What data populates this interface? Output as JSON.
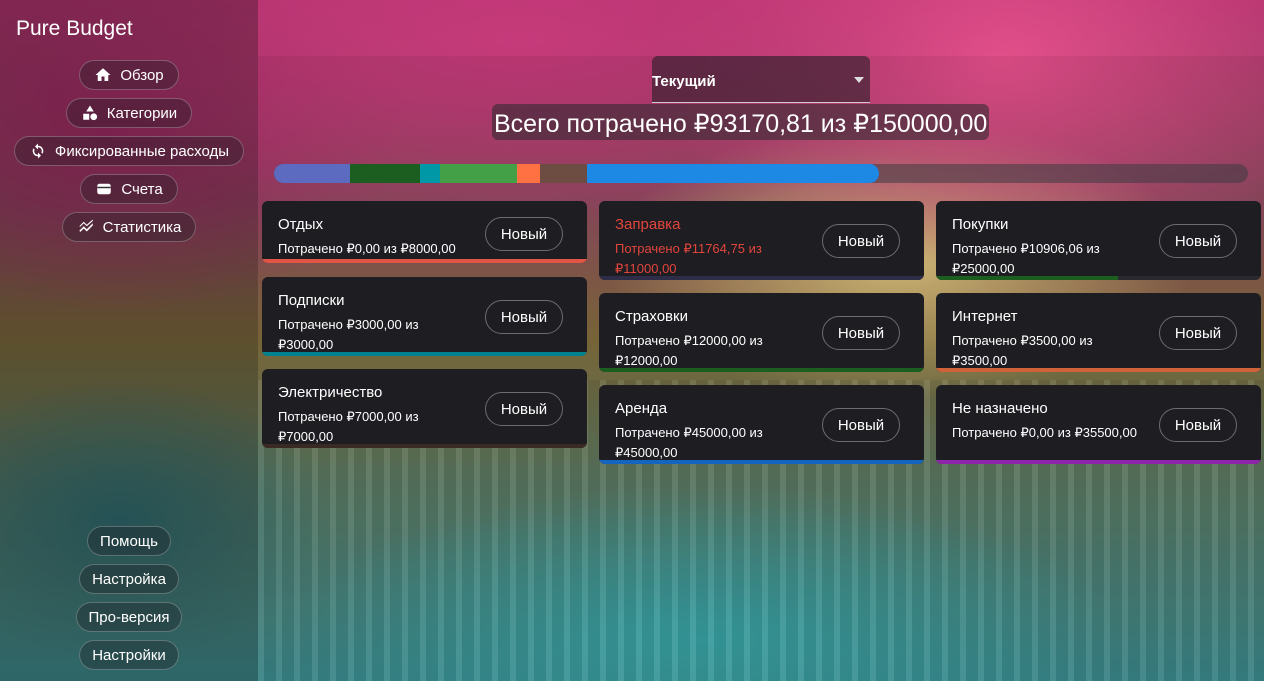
{
  "app": {
    "title": "Pure Budget"
  },
  "nav": {
    "items": [
      {
        "label": "Обзор",
        "icon": "home-icon"
      },
      {
        "label": "Категории",
        "icon": "shapes-icon"
      },
      {
        "label": "Фиксированные расходы",
        "icon": "refresh-icon"
      },
      {
        "label": "Счета",
        "icon": "wallet-icon"
      },
      {
        "label": "Статистика",
        "icon": "chart-icon"
      }
    ],
    "bottom": [
      {
        "label": "Помощь"
      },
      {
        "label": "Настройка"
      },
      {
        "label": "Про-версия"
      },
      {
        "label": "Настройки"
      }
    ]
  },
  "period": {
    "selected": "Текущий"
  },
  "summary": {
    "total_text": "Всего потрачено ₽93170,81 из ₽150000,00"
  },
  "budget_bar": {
    "segments": [
      {
        "color": "#5c6bc0",
        "fraction": 0.078
      },
      {
        "color": "#1b5e20",
        "fraction": 0.072
      },
      {
        "color": "#0097a7",
        "fraction": 0.02
      },
      {
        "color": "#43a047",
        "fraction": 0.08
      },
      {
        "color": "#ff7043",
        "fraction": 0.023
      },
      {
        "color": "#6d4c41",
        "fraction": 0.048
      },
      {
        "color": "#1e88e5",
        "fraction": 0.3
      }
    ]
  },
  "cards": [
    {
      "name": "Отдых",
      "spent": "Потрачено ₽0,00 из ₽8000,00",
      "button": "Новый",
      "bar_color": "#e05545",
      "fill": 1.0,
      "over": false
    },
    {
      "name": "Подписки",
      "spent": "Потрачено ₽3000,00 из ₽3000,00",
      "button": "Новый",
      "bar_color": "#00838f",
      "fill": 1.0,
      "over": false
    },
    {
      "name": "Электричество",
      "spent": "Потрачено ₽7000,00 из ₽7000,00",
      "button": "Новый",
      "bar_color": "#3a2a26",
      "fill": 1.0,
      "over": false
    },
    {
      "name": "Заправка",
      "spent": "Потрачено ₽11764,75 из ₽11000,00",
      "button": "Новый",
      "bar_color": "#2e2d48",
      "fill": 1.0,
      "over": true
    },
    {
      "name": "Страховки",
      "spent": "Потрачено ₽12000,00 из ₽12000,00",
      "button": "Новый",
      "bar_color": "#1b5e20",
      "fill": 1.0,
      "over": false
    },
    {
      "name": "Аренда",
      "spent": "Потрачено ₽45000,00 из ₽45000,00",
      "button": "Новый",
      "bar_color": "#1565c0",
      "fill": 1.0,
      "over": false
    },
    {
      "name": "Покупки",
      "spent": "Потрачено ₽10906,06 из ₽25000,00",
      "button": "Новый",
      "bar_color": "#1b5e20",
      "fill": 0.56,
      "over": false
    },
    {
      "name": "Интернет",
      "spent": "Потрачено ₽3500,00 из ₽3500,00",
      "button": "Новый",
      "bar_color": "#d0623a",
      "fill": 1.0,
      "over": false
    },
    {
      "name": "Не назначено",
      "spent": "Потрачено ₽0,00 из ₽35500,00",
      "button": "Новый",
      "bar_color": "#8e24aa",
      "fill": 1.0,
      "over": false
    }
  ]
}
